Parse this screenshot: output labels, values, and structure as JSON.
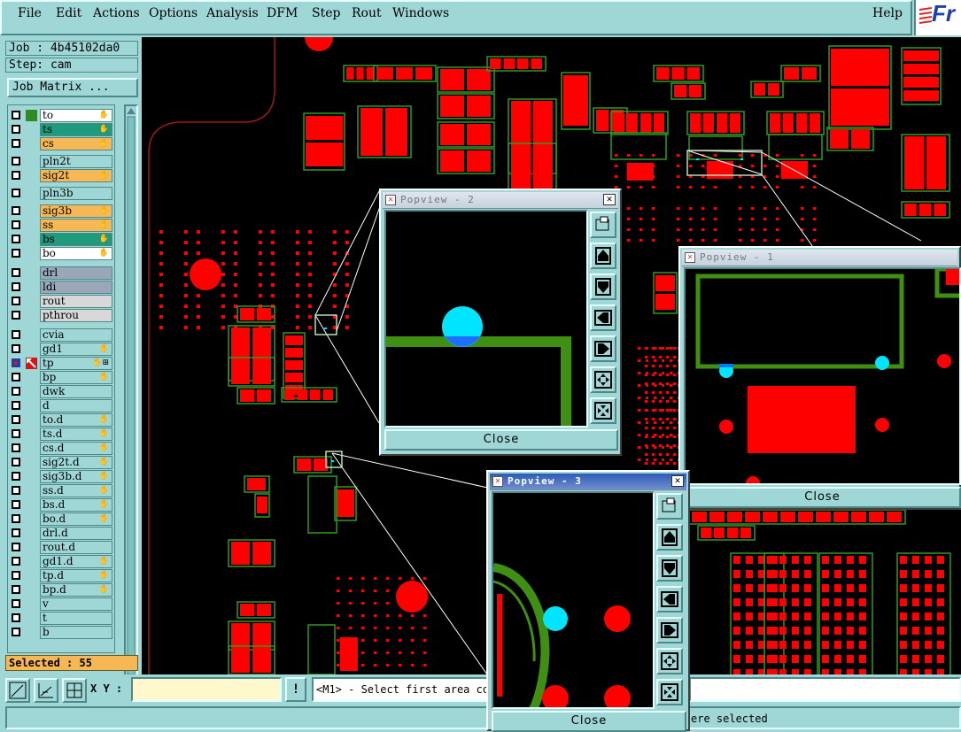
{
  "menubar": {
    "items": [
      "File",
      "Edit",
      "Actions",
      "Options",
      "Analysis",
      "DFM",
      "Step",
      "Rout",
      "Windows"
    ],
    "help": "Help",
    "logo_text": "Fr"
  },
  "job": {
    "job_line": "Job : 4b45102da0",
    "step_line": "Step: cam",
    "matrix_button": "Job Matrix ..."
  },
  "layers": [
    {
      "name": "to",
      "color": "#ffffff",
      "mark": "#2e8b22",
      "hand": "✋"
    },
    {
      "name": "ts",
      "color": "#1f9a7a",
      "hand": "✋"
    },
    {
      "name": "cs",
      "color": "#f5b854",
      "hand": "✋"
    },
    {
      "name": "pln2t",
      "color": "#9fd6d6"
    },
    {
      "name": "sig2t",
      "color": "#f5b854",
      "hand": "✋"
    },
    {
      "name": "pln3b",
      "color": "#9fd6d6"
    },
    {
      "name": "sig3b",
      "color": "#f5b854",
      "hand": "✋"
    },
    {
      "name": "ss",
      "color": "#f5b854",
      "hand": "✋"
    },
    {
      "name": "bs",
      "color": "#1f9a7a",
      "hand": "✋"
    },
    {
      "name": "bo",
      "color": "#ffffff",
      "hand": "✋"
    },
    {
      "name": "drl",
      "color": "#9aa7b8"
    },
    {
      "name": "ldi",
      "color": "#9aa7b8"
    },
    {
      "name": "rout",
      "color": "#d8d8d8"
    },
    {
      "name": "pthrou",
      "color": "#d8d8d8"
    },
    {
      "name": "cvia",
      "color": "#9fd6d6"
    },
    {
      "name": "gd1",
      "color": "#9fd6d6",
      "hand": "✋"
    },
    {
      "name": "tp",
      "color": "#9fd6d6",
      "hand": "✋⊞",
      "active": true
    },
    {
      "name": "bp",
      "color": "#9fd6d6",
      "hand": "✋"
    },
    {
      "name": "dwk",
      "color": "#9fd6d6"
    },
    {
      "name": "d",
      "color": "#9fd6d6"
    },
    {
      "name": "to.d",
      "color": "#9fd6d6",
      "hand": "✋"
    },
    {
      "name": "ts.d",
      "color": "#9fd6d6",
      "hand": "✋"
    },
    {
      "name": "cs.d",
      "color": "#9fd6d6",
      "hand": "✋"
    },
    {
      "name": "sig2t.d",
      "color": "#9fd6d6",
      "hand": "✋"
    },
    {
      "name": "sig3b.d",
      "color": "#9fd6d6",
      "hand": "✋"
    },
    {
      "name": "ss.d",
      "color": "#9fd6d6",
      "hand": "✋"
    },
    {
      "name": "bs.d",
      "color": "#9fd6d6",
      "hand": "✋"
    },
    {
      "name": "bo.d",
      "color": "#9fd6d6",
      "hand": "✋"
    },
    {
      "name": "drl.d",
      "color": "#9fd6d6"
    },
    {
      "name": "rout.d",
      "color": "#9fd6d6"
    },
    {
      "name": "gd1.d",
      "color": "#9fd6d6",
      "hand": "✋"
    },
    {
      "name": "tp.d",
      "color": "#9fd6d6",
      "hand": "✋"
    },
    {
      "name": "bp.d",
      "color": "#9fd6d6",
      "hand": "✋"
    },
    {
      "name": "v",
      "color": "#9fd6d6"
    },
    {
      "name": "t",
      "color": "#9fd6d6"
    },
    {
      "name": "b",
      "color": "#9fd6d6"
    }
  ],
  "selected": "Selected : 55",
  "bottom": {
    "xy_label": "X Y :",
    "bang": "!",
    "prompt": "<M1> - Select first area co",
    "status": "ere selected"
  },
  "popups": {
    "p2": {
      "title": "Popview - 2",
      "close": "Close"
    },
    "p1": {
      "title": "Popview - 1",
      "close": "Close"
    },
    "p3": {
      "title": "Popview - 3",
      "close": "Close"
    }
  },
  "colors": {
    "panel": "#9fd6d6",
    "pad": "#ff0000",
    "outline": "#2f9a1f",
    "trace": "#3f8f12",
    "highlight": "#00e5ff",
    "selected_bg": "#f5b854"
  },
  "icons": [
    "zoom-fit-icon",
    "zoom-area-icon",
    "grid-icon",
    "close-icon",
    "popview-tool-icon"
  ]
}
